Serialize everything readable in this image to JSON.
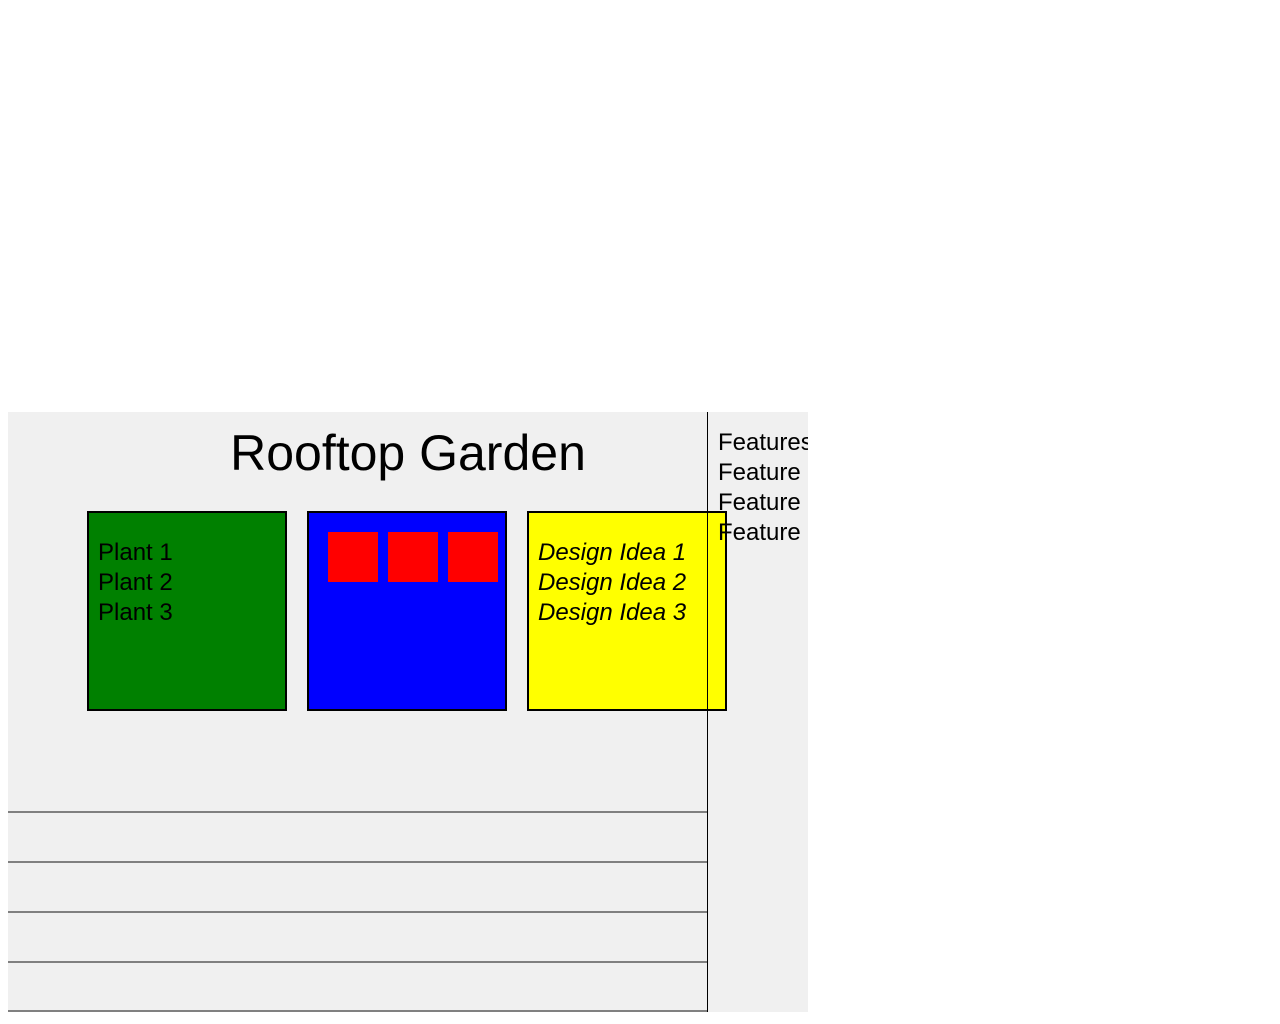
{
  "title": "Rooftop Garden",
  "plants": {
    "items": [
      "Plant 1",
      "Plant 2",
      "Plant 3"
    ],
    "color": "#008000"
  },
  "gallery": {
    "color": "#0000ff",
    "swatch_color": "#ff0000"
  },
  "design_ideas": {
    "items": [
      "Design Idea 1",
      "Design Idea 2",
      "Design Idea 3"
    ],
    "color": "#ffff00"
  },
  "sidebar": {
    "heading": "Features",
    "items": [
      "Feature",
      "Feature",
      "Feature"
    ]
  },
  "page_background": "#f0f0f0"
}
